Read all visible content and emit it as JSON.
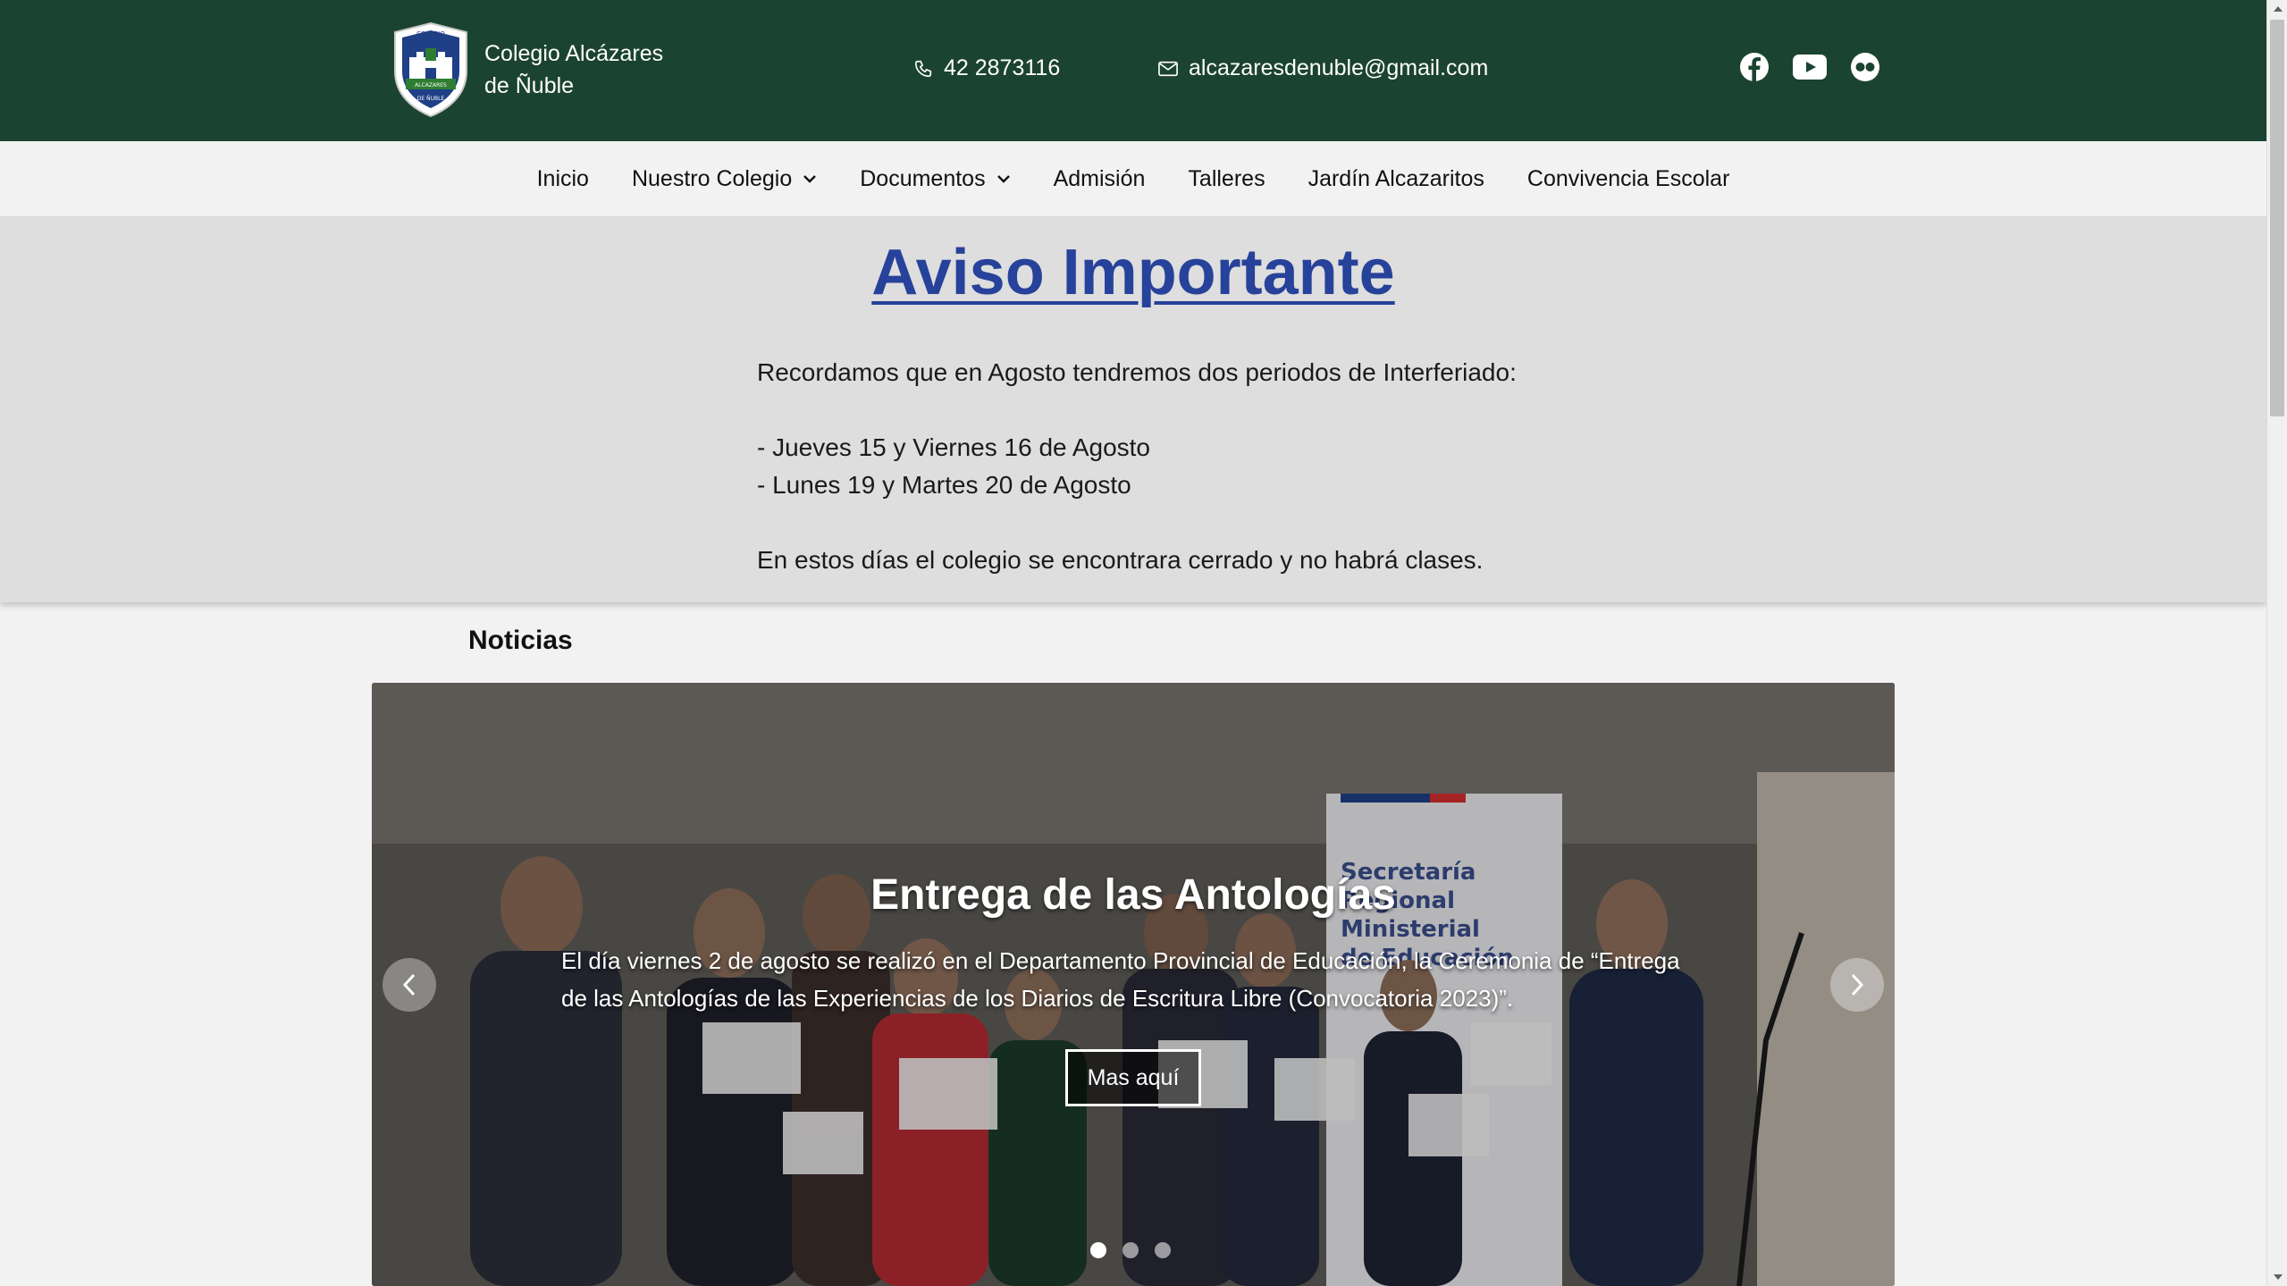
{
  "header": {
    "school_name_line1": "Colegio Alcázares",
    "school_name_line2": "de Ñuble",
    "logo_text_top": "COLEGIO",
    "logo_text_mid": "ALCAZARES",
    "logo_text_bottom": "DE ÑUBLE",
    "phone": "42 2873116",
    "email": "alcazaresdenuble@gmail.com",
    "socials": [
      "facebook-icon",
      "youtube-icon",
      "flickr-icon"
    ],
    "background_color": "#1b4332"
  },
  "nav": {
    "items": [
      {
        "label": "Inicio",
        "has_dropdown": false
      },
      {
        "label": "Nuestro Colegio",
        "has_dropdown": true
      },
      {
        "label": "Documentos",
        "has_dropdown": true
      },
      {
        "label": "Admisión",
        "has_dropdown": false
      },
      {
        "label": "Talleres",
        "has_dropdown": false
      },
      {
        "label": "Jardín Alcazaritos",
        "has_dropdown": false
      },
      {
        "label": "Convivencia Escolar",
        "has_dropdown": false
      }
    ]
  },
  "notice": {
    "title": "Aviso Importante",
    "title_color": "#27429a",
    "lines": [
      "Recordamos que en Agosto tendremos dos periodos de Interferiado:",
      "",
      "- Jueves 15 y Viernes 16 de Agosto",
      "- Lunes 19 y Martes 20 de Agosto",
      "",
      "En estos días el colegio se encontrara cerrado y no habrá clases."
    ]
  },
  "news": {
    "section_title": "Noticias",
    "slide": {
      "title": "Entrega de las Antologías",
      "description": "El día viernes 2 de agosto se realizó en el Departamento Provincial de Educación, la Ceremonia de “Entrega de las Antologías de las Experiencias de los Diarios de Escritura Libre (Convocatoria 2023)”.",
      "button_label": "Mas aquí",
      "banner_text": "Secretaría Regional Ministerial de Educación"
    },
    "slide_count": 3,
    "active_slide": 1
  }
}
